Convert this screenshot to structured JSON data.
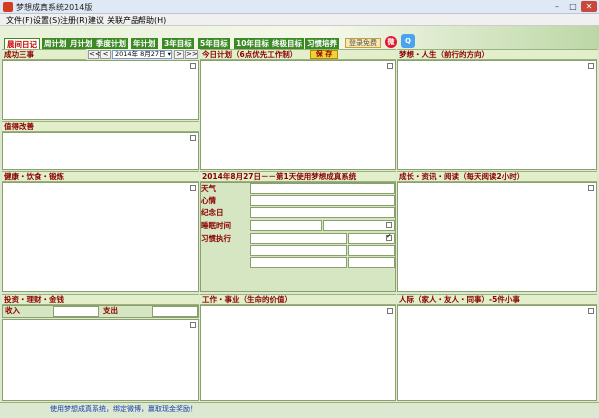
{
  "window": {
    "title": "梦想成真系统2014版",
    "min": "–",
    "max": "□",
    "close": "✕"
  },
  "menu": {
    "items": [
      "文件(F)",
      "设置(S)",
      "注册(R)",
      "建议",
      "关联产品",
      "帮助(H)"
    ]
  },
  "tabs": [
    "晨间日记",
    "周计划",
    "月计划",
    "季度计划",
    "年计划",
    "3年目标",
    "5年目标",
    "10年目标",
    "终极目标",
    "习惯培养"
  ],
  "toolbar": {
    "login": "登录免费",
    "weibo": "微",
    "qq": "Q"
  },
  "nav": {
    "first": "<<",
    "prev": "<",
    "date": "2014年 8月27日 ▾",
    "next": ">",
    "last": ">>",
    "save": "保 存"
  },
  "sections": {
    "success": "成功三事",
    "improve": "值得改善",
    "today_plan": "今日计划（6点优先工作制）",
    "dream_life": "梦想・人生（前行的方向）",
    "health": "健康・饮食・锻炼",
    "diary_header": "2014年8月27日－－第1天使用梦想成真系统",
    "growth": "成长・资讯・阅读（每天阅读2小时）",
    "finance": "投资・理财・金钱",
    "career": "工作・事业（生命的价值）",
    "relations": "人际（家人・友人・同事）-5件小事"
  },
  "diary": {
    "weather": "天气",
    "mood": "心情",
    "anniversary": "纪念日",
    "sleep": "睡眠时间",
    "habit": "习惯执行"
  },
  "finance": {
    "income": "收入",
    "expense": "支出"
  },
  "status": {
    "text": "使用梦想成真系统，绑定微博，赢取现金奖励！"
  }
}
